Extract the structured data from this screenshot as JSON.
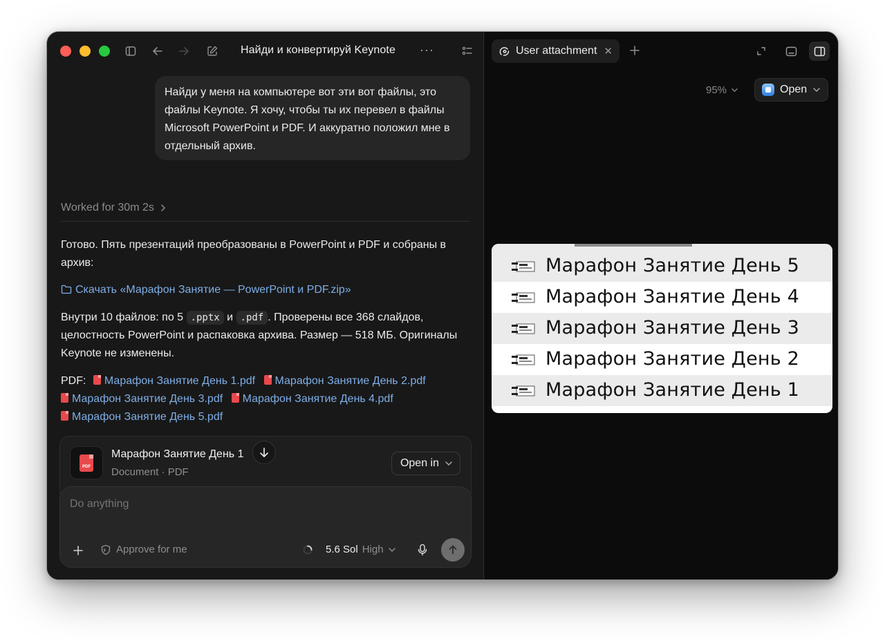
{
  "window": {
    "title": "Найди и конвертируй Keynote",
    "more_label": "···"
  },
  "chat": {
    "user_message": "Найди у меня на компьютере вот эти вот файлы, это файлы Keynote. Я хочу, чтобы ты их перевел в файлы Microsoft PowerPoint и PDF. И аккуратно положил мне в отдельный архив.",
    "worked_label": "Worked for 30m 2s",
    "reply": {
      "intro": "Готово. Пять презентаций преобразованы в PowerPoint и PDF и собраны в архив:",
      "download_link": "Скачать «Марафон Занятие — PowerPoint и PDF.zip»",
      "contents_prefix": "Внутри 10 файлов: по 5",
      "code_pptx": ".pptx",
      "contents_and": "и",
      "code_pdf": ".pdf",
      "contents_suffix": ". Проверены все 368 слайдов, целостность PowerPoint и распаковка архива. Размер — 518 МБ. Оригиналы Keynote не изменены.",
      "pdf_label": "PDF:",
      "pdf_links": [
        "Марафон Занятие День 1.pdf",
        "Марафон Занятие День 2.pdf",
        "Марафон Занятие День 3.pdf",
        "Марафон Занятие День 4.pdf",
        "Марафон Занятие День 5.pdf"
      ]
    },
    "attachment": {
      "name": "Марафон Занятие День 1",
      "meta": "Document · PDF",
      "open_in_label": "Open in",
      "thumb_label": "PDF"
    },
    "composer": {
      "placeholder": "Do anything",
      "approve_label": "Approve for me",
      "model_name": "5.6 Sol",
      "model_level": "High"
    }
  },
  "viewer": {
    "tab_label": "User attachment",
    "zoom": "95%",
    "open_label": "Open",
    "image_files": [
      "Марафон Занятие День 5",
      "Марафон Занятие  День 4",
      "Марафон Занятие День 3",
      "Марафон Занятие День 2",
      "Марафон Занятие  День 1"
    ]
  },
  "colors": {
    "accent_link": "#7eaee6",
    "pdf_red": "#e8494b",
    "traffic_red": "#fe5f57",
    "traffic_yellow": "#febc2e",
    "traffic_green": "#28c840"
  }
}
